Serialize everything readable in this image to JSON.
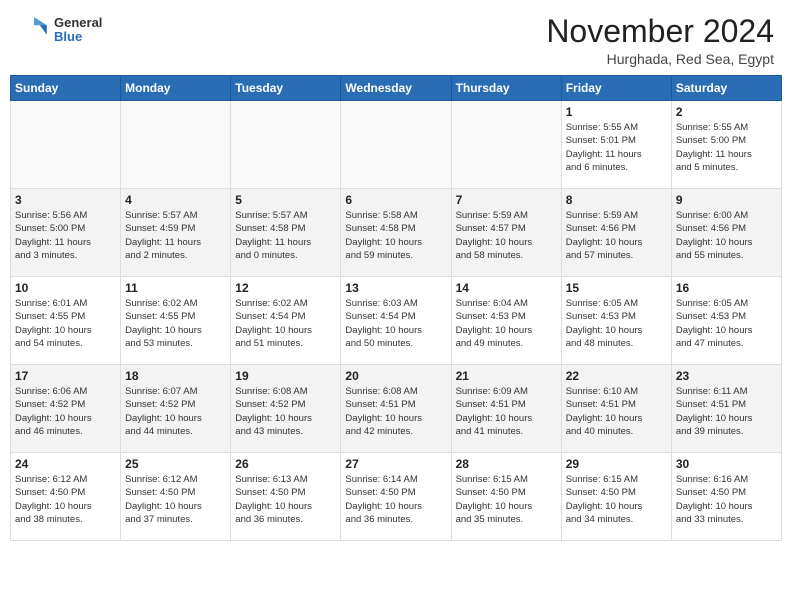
{
  "header": {
    "logo_general": "General",
    "logo_blue": "Blue",
    "month_title": "November 2024",
    "location": "Hurghada, Red Sea, Egypt"
  },
  "calendar": {
    "headers": [
      "Sunday",
      "Monday",
      "Tuesday",
      "Wednesday",
      "Thursday",
      "Friday",
      "Saturday"
    ],
    "weeks": [
      [
        {
          "day": "",
          "info": "",
          "empty": true
        },
        {
          "day": "",
          "info": "",
          "empty": true
        },
        {
          "day": "",
          "info": "",
          "empty": true
        },
        {
          "day": "",
          "info": "",
          "empty": true
        },
        {
          "day": "",
          "info": "",
          "empty": true
        },
        {
          "day": "1",
          "info": "Sunrise: 5:55 AM\nSunset: 5:01 PM\nDaylight: 11 hours\nand 6 minutes."
        },
        {
          "day": "2",
          "info": "Sunrise: 5:55 AM\nSunset: 5:00 PM\nDaylight: 11 hours\nand 5 minutes."
        }
      ],
      [
        {
          "day": "3",
          "info": "Sunrise: 5:56 AM\nSunset: 5:00 PM\nDaylight: 11 hours\nand 3 minutes."
        },
        {
          "day": "4",
          "info": "Sunrise: 5:57 AM\nSunset: 4:59 PM\nDaylight: 11 hours\nand 2 minutes."
        },
        {
          "day": "5",
          "info": "Sunrise: 5:57 AM\nSunset: 4:58 PM\nDaylight: 11 hours\nand 0 minutes."
        },
        {
          "day": "6",
          "info": "Sunrise: 5:58 AM\nSunset: 4:58 PM\nDaylight: 10 hours\nand 59 minutes."
        },
        {
          "day": "7",
          "info": "Sunrise: 5:59 AM\nSunset: 4:57 PM\nDaylight: 10 hours\nand 58 minutes."
        },
        {
          "day": "8",
          "info": "Sunrise: 5:59 AM\nSunset: 4:56 PM\nDaylight: 10 hours\nand 57 minutes."
        },
        {
          "day": "9",
          "info": "Sunrise: 6:00 AM\nSunset: 4:56 PM\nDaylight: 10 hours\nand 55 minutes."
        }
      ],
      [
        {
          "day": "10",
          "info": "Sunrise: 6:01 AM\nSunset: 4:55 PM\nDaylight: 10 hours\nand 54 minutes."
        },
        {
          "day": "11",
          "info": "Sunrise: 6:02 AM\nSunset: 4:55 PM\nDaylight: 10 hours\nand 53 minutes."
        },
        {
          "day": "12",
          "info": "Sunrise: 6:02 AM\nSunset: 4:54 PM\nDaylight: 10 hours\nand 51 minutes."
        },
        {
          "day": "13",
          "info": "Sunrise: 6:03 AM\nSunset: 4:54 PM\nDaylight: 10 hours\nand 50 minutes."
        },
        {
          "day": "14",
          "info": "Sunrise: 6:04 AM\nSunset: 4:53 PM\nDaylight: 10 hours\nand 49 minutes."
        },
        {
          "day": "15",
          "info": "Sunrise: 6:05 AM\nSunset: 4:53 PM\nDaylight: 10 hours\nand 48 minutes."
        },
        {
          "day": "16",
          "info": "Sunrise: 6:05 AM\nSunset: 4:53 PM\nDaylight: 10 hours\nand 47 minutes."
        }
      ],
      [
        {
          "day": "17",
          "info": "Sunrise: 6:06 AM\nSunset: 4:52 PM\nDaylight: 10 hours\nand 46 minutes."
        },
        {
          "day": "18",
          "info": "Sunrise: 6:07 AM\nSunset: 4:52 PM\nDaylight: 10 hours\nand 44 minutes."
        },
        {
          "day": "19",
          "info": "Sunrise: 6:08 AM\nSunset: 4:52 PM\nDaylight: 10 hours\nand 43 minutes."
        },
        {
          "day": "20",
          "info": "Sunrise: 6:08 AM\nSunset: 4:51 PM\nDaylight: 10 hours\nand 42 minutes."
        },
        {
          "day": "21",
          "info": "Sunrise: 6:09 AM\nSunset: 4:51 PM\nDaylight: 10 hours\nand 41 minutes."
        },
        {
          "day": "22",
          "info": "Sunrise: 6:10 AM\nSunset: 4:51 PM\nDaylight: 10 hours\nand 40 minutes."
        },
        {
          "day": "23",
          "info": "Sunrise: 6:11 AM\nSunset: 4:51 PM\nDaylight: 10 hours\nand 39 minutes."
        }
      ],
      [
        {
          "day": "24",
          "info": "Sunrise: 6:12 AM\nSunset: 4:50 PM\nDaylight: 10 hours\nand 38 minutes."
        },
        {
          "day": "25",
          "info": "Sunrise: 6:12 AM\nSunset: 4:50 PM\nDaylight: 10 hours\nand 37 minutes."
        },
        {
          "day": "26",
          "info": "Sunrise: 6:13 AM\nSunset: 4:50 PM\nDaylight: 10 hours\nand 36 minutes."
        },
        {
          "day": "27",
          "info": "Sunrise: 6:14 AM\nSunset: 4:50 PM\nDaylight: 10 hours\nand 36 minutes."
        },
        {
          "day": "28",
          "info": "Sunrise: 6:15 AM\nSunset: 4:50 PM\nDaylight: 10 hours\nand 35 minutes."
        },
        {
          "day": "29",
          "info": "Sunrise: 6:15 AM\nSunset: 4:50 PM\nDaylight: 10 hours\nand 34 minutes."
        },
        {
          "day": "30",
          "info": "Sunrise: 6:16 AM\nSunset: 4:50 PM\nDaylight: 10 hours\nand 33 minutes."
        }
      ]
    ]
  }
}
